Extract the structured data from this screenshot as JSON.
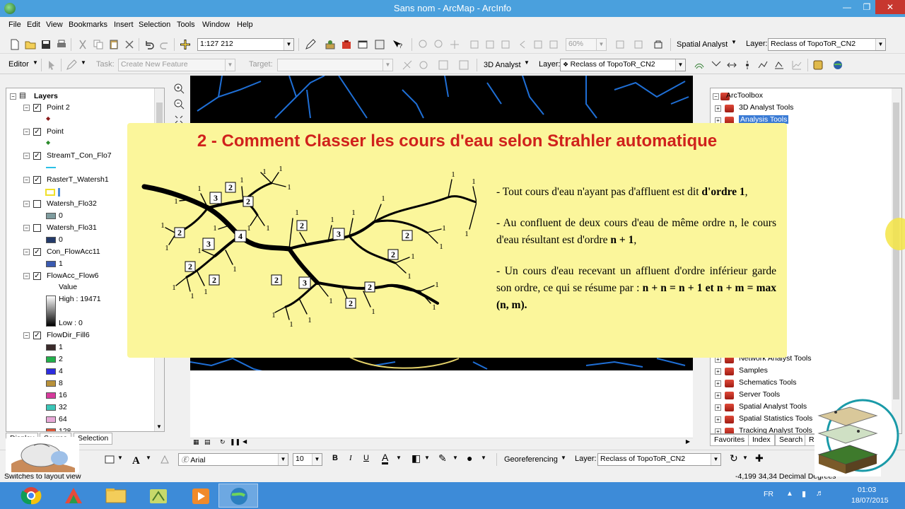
{
  "window": {
    "title": "Sans nom - ArcMap - ArcInfo"
  },
  "menu": [
    "File",
    "Edit",
    "View",
    "Bookmarks",
    "Insert",
    "Selection",
    "Tools",
    "Window",
    "Help"
  ],
  "toolbar1": {
    "scale": "1:127 212",
    "zoom": "60%",
    "spatial_analyst": "Spatial Analyst",
    "layer_label": "Layer:",
    "layer_value": "Reclass of TopoToR_CN2"
  },
  "toolbar2": {
    "editor": "Editor",
    "task_label": "Task:",
    "task_value": "Create New Feature",
    "target_label": "Target:",
    "target_value": "",
    "analyst_3d": "3D Analyst",
    "layer_label": "Layer:",
    "layer_value": "Reclass of TopoToR_CN2"
  },
  "toc": {
    "root": "Layers",
    "layers": [
      {
        "name": "Point 2",
        "checked": true
      },
      {
        "name": "Point",
        "checked": true
      },
      {
        "name": "StreamT_Con_Flo7",
        "checked": true
      },
      {
        "name": "RasterT_Watersh1",
        "checked": true
      },
      {
        "name": "Watersh_Flo32",
        "checked": false,
        "legend": "0"
      },
      {
        "name": "Watersh_Flo31",
        "checked": false,
        "legend": "0"
      },
      {
        "name": "Con_FlowAcc11",
        "checked": true,
        "legend": "1"
      },
      {
        "name": "FlowAcc_Flow6",
        "checked": true
      },
      {
        "name": "FlowDir_Fill6",
        "checked": true
      }
    ],
    "flowacc_value_label": "Value",
    "flowacc_high": "High : 19471",
    "flowacc_low": "Low : 0",
    "flowdir_classes": [
      {
        "label": "1",
        "color": "#3a2b2b"
      },
      {
        "label": "2",
        "color": "#22b14c"
      },
      {
        "label": "4",
        "color": "#2d2de0"
      },
      {
        "label": "8",
        "color": "#b8913a"
      },
      {
        "label": "16",
        "color": "#d63a9c"
      },
      {
        "label": "32",
        "color": "#3bc6b8"
      },
      {
        "label": "64",
        "color": "#e8a9d8"
      },
      {
        "label": "128",
        "color": "#e05a3a"
      }
    ],
    "tabs": [
      "Display",
      "Source",
      "Selection"
    ]
  },
  "toolbox": {
    "root": "ArcToolbox",
    "items": [
      "3D Analyst Tools",
      "Analysis Tools",
      "Tools",
      "ools",
      "er",
      "ge",
      "abase",
      "le",
      "rability Tools",
      "ment Tools",
      "ols",
      "Analyst Tools",
      "cing Tools",
      "on Tools",
      "Network Analyst Tools",
      "Samples",
      "Schematics Tools",
      "Server Tools",
      "Spatial Analyst Tools",
      "Spatial Statistics Tools",
      "Tracking Analyst Tools"
    ],
    "tabs": [
      "Favorites",
      "Index",
      "Search",
      "R"
    ]
  },
  "slide": {
    "title": "2 - Comment Classer les cours d'eau selon Strahler automatique",
    "p1": "- Tout cours d'eau n'ayant pas d'affluent est dit ",
    "p1_bold": "d'ordre 1",
    "p1_end": ",",
    "p2": "- Au confluent de deux cours d'eau de même ordre n, le cours d'eau résultant est d'ordre ",
    "p2_bold": "n + 1",
    "p2_end": ",",
    "p3": "- Un cours d'eau recevant un affluent d'ordre inférieur garde son ordre, ce qui se résume par : ",
    "p3_bold": "n + n = n + 1 et n + m = max (n, m).",
    "tree_labels": {
      "order1": "1",
      "order2": "2",
      "order3": "3",
      "order4": "4"
    }
  },
  "drawbar": {
    "font": "Arial",
    "size": "10",
    "georeferencing": "Georeferencing",
    "layer_label": "Layer:",
    "layer_value": "Reclass of TopoToR_CN2"
  },
  "status": {
    "left": "Switches to layout view",
    "coords": "-4,199  34,34 Decimal Degrees"
  },
  "tray": {
    "lang": "FR",
    "time": "01:03",
    "date": "18/07/2015"
  },
  "colors": {
    "title_bar": "#4aa0dd",
    "taskbar": "#3d8bd8",
    "slide_bg": "#fbf69b",
    "slide_title": "#d0211c",
    "stream": "#1f6fd6"
  }
}
